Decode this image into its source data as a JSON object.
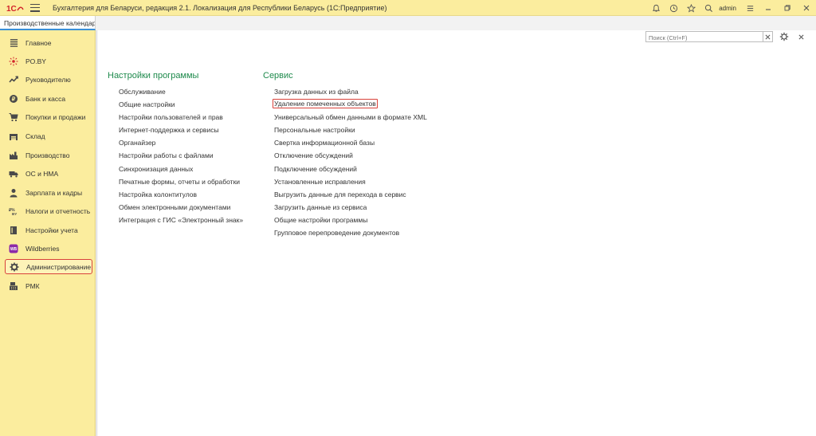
{
  "app": {
    "title": "Бухгалтерия для Беларуси, редакция 2.1. Локализация для Республики Беларусь   (1С:Предприятие)",
    "user": "admin",
    "logo_text": "1С"
  },
  "tabs": [
    {
      "label": "Производственные календари"
    }
  ],
  "sidebar": {
    "items": [
      {
        "label": "Главное",
        "icon": "list-icon"
      },
      {
        "label": "PO.BY",
        "icon": "sun-icon"
      },
      {
        "label": "Руководителю",
        "icon": "trend-icon"
      },
      {
        "label": "Банк и касса",
        "icon": "coin-icon"
      },
      {
        "label": "Покупки и продажи",
        "icon": "cart-icon"
      },
      {
        "label": "Склад",
        "icon": "warehouse-icon"
      },
      {
        "label": "Производство",
        "icon": "factory-icon"
      },
      {
        "label": "ОС и НМА",
        "icon": "truck-icon"
      },
      {
        "label": "Зарплата и кадры",
        "icon": "person-icon"
      },
      {
        "label": "Налоги и отчетность",
        "icon": "tax-icon"
      },
      {
        "label": "Настройки учета",
        "icon": "book-icon"
      },
      {
        "label": "Wildberries",
        "icon": "wb-icon"
      },
      {
        "label": "Администрирование",
        "icon": "gear-icon"
      },
      {
        "label": "РМК",
        "icon": "register-icon"
      }
    ],
    "active_index": 12
  },
  "search": {
    "placeholder": "Поиск (Ctrl+F)",
    "value": ""
  },
  "sections": {
    "settings": {
      "title": "Настройки программы",
      "links": [
        "Обслуживание",
        "Общие настройки",
        "Настройки пользователей и прав",
        "Интернет-поддержка и сервисы",
        "Органайзер",
        "Настройки работы с файлами",
        "Синхронизация данных",
        "Печатные формы, отчеты и обработки",
        "Настройка колонтитулов",
        "Обмен электронными документами",
        "Интеграция с ГИС «Электронный знак»"
      ]
    },
    "service": {
      "title": "Сервис",
      "links": [
        "Загрузка данных из файла",
        "Удаление помеченных объектов",
        "Универсальный обмен данными в формате XML",
        "Персональные настройки",
        "Свертка информационной базы",
        "Отключение обсуждений",
        "Подключение обсуждений",
        "Установленные исправления",
        "Выгрузить данные для перехода в сервис",
        "Загрузить данные из сервиса",
        "Общие настройки программы",
        "Групповое перепроведение документов"
      ],
      "highlight_index": 1
    }
  },
  "colors": {
    "accent_yellow": "#fbed9e",
    "section_green": "#1e8a4c",
    "highlight_red": "#d9423a"
  }
}
